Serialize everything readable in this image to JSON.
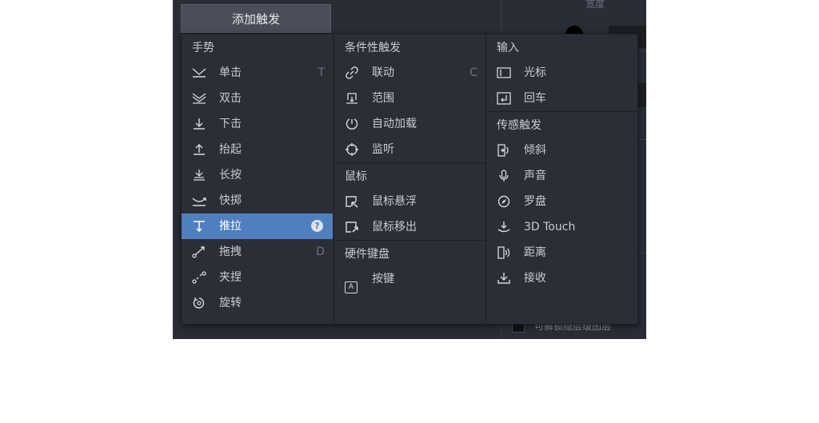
{
  "add_trigger_button": "添加触发",
  "background": {
    "top_right_label": "宽度",
    "bottom_checkbox_label": "可解锁隐层级图层"
  },
  "gestures": {
    "title": "手势",
    "items": [
      {
        "label": "单击",
        "icon": "tap-icon",
        "shortcut": "T"
      },
      {
        "label": "双击",
        "icon": "double-tap-icon",
        "shortcut": ""
      },
      {
        "label": "下击",
        "icon": "touch-down-icon",
        "shortcut": ""
      },
      {
        "label": "抬起",
        "icon": "touch-up-icon",
        "shortcut": ""
      },
      {
        "label": "长按",
        "icon": "long-press-icon",
        "shortcut": ""
      },
      {
        "label": "快掷",
        "icon": "flick-icon",
        "shortcut": ""
      },
      {
        "label": "推拉",
        "icon": "pull-icon",
        "shortcut": "",
        "active": true,
        "help": "?"
      },
      {
        "label": "拖拽",
        "icon": "drag-icon",
        "shortcut": "D"
      },
      {
        "label": "夹捏",
        "icon": "pinch-icon",
        "shortcut": ""
      },
      {
        "label": "旋转",
        "icon": "rotate-icon",
        "shortcut": ""
      }
    ]
  },
  "conditional": {
    "title": "条件性触发",
    "items": [
      {
        "label": "联动",
        "icon": "link-icon",
        "shortcut": "C"
      },
      {
        "label": "范围",
        "icon": "range-icon",
        "shortcut": ""
      },
      {
        "label": "自动加载",
        "icon": "auto-load-icon",
        "shortcut": ""
      },
      {
        "label": "监听",
        "icon": "listen-icon",
        "shortcut": ""
      }
    ]
  },
  "mouse": {
    "title": "鼠标",
    "items": [
      {
        "label": "鼠标悬浮",
        "icon": "mouse-hover-icon"
      },
      {
        "label": "鼠标移出",
        "icon": "mouse-out-icon"
      }
    ]
  },
  "keyboard": {
    "title": "硬件键盘",
    "items": [
      {
        "label": "按键",
        "icon": "key-icon",
        "keycap": "A"
      }
    ]
  },
  "input": {
    "title": "输入",
    "items": [
      {
        "label": "光标",
        "icon": "cursor-icon"
      },
      {
        "label": "回车",
        "icon": "return-icon"
      }
    ]
  },
  "sensor": {
    "title": "传感触发",
    "items": [
      {
        "label": "倾斜",
        "icon": "tilt-icon"
      },
      {
        "label": "声音",
        "icon": "microphone-icon"
      },
      {
        "label": "罗盘",
        "icon": "compass-icon"
      },
      {
        "label": "3D Touch",
        "icon": "3d-touch-icon"
      },
      {
        "label": "距离",
        "icon": "proximity-icon"
      },
      {
        "label": "接收",
        "icon": "receive-icon"
      }
    ]
  },
  "colors": {
    "panel": "#2b2e37",
    "active": "#4f7fbf",
    "text": "#c9cbd0"
  }
}
